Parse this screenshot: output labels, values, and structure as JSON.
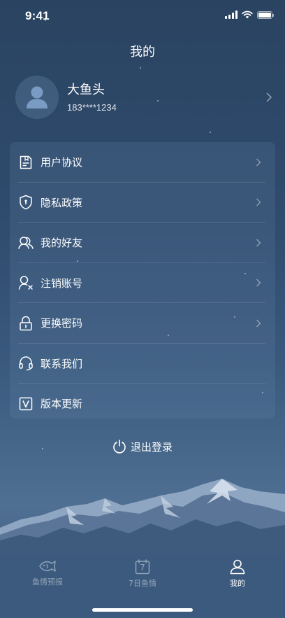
{
  "status_bar": {
    "time": "9:41",
    "signal_icon": "cellular-signal-icon",
    "wifi_icon": "wifi-icon",
    "battery_icon": "battery-icon",
    "battery_level": 1.0
  },
  "header": {
    "title": "我的"
  },
  "profile": {
    "avatar_icon": "user-avatar-icon",
    "name": "大鱼头",
    "phone": "183****1234"
  },
  "menu": {
    "items": [
      {
        "label": "用户协议",
        "icon": "document-icon",
        "has_chevron": true
      },
      {
        "label": "隐私政策",
        "icon": "shield-icon",
        "has_chevron": true
      },
      {
        "label": "我的好友",
        "icon": "friends-icon",
        "has_chevron": true
      },
      {
        "label": "注销账号",
        "icon": "user-remove-icon",
        "has_chevron": true
      },
      {
        "label": "更换密码",
        "icon": "lock-icon",
        "has_chevron": true
      },
      {
        "label": "联系我们",
        "icon": "headset-icon",
        "has_chevron": false
      },
      {
        "label": "版本更新",
        "icon": "version-icon",
        "has_chevron": false
      }
    ]
  },
  "logout": {
    "label": "退出登录",
    "icon": "power-icon"
  },
  "tab_bar": {
    "tabs": [
      {
        "label": "鱼情预报",
        "icon": "fish-icon",
        "active": false
      },
      {
        "label": "7日鱼情",
        "icon": "calendar-7-icon",
        "active": false,
        "icon_text": "7"
      },
      {
        "label": "我的",
        "icon": "profile-icon",
        "active": true
      }
    ]
  },
  "colors": {
    "background_top": "#2a4361",
    "background_bottom": "#4f6f93",
    "tab_bar": "#3b5a7e",
    "active_tab": "#ffffff",
    "inactive_tab": "#8fa3ba"
  }
}
